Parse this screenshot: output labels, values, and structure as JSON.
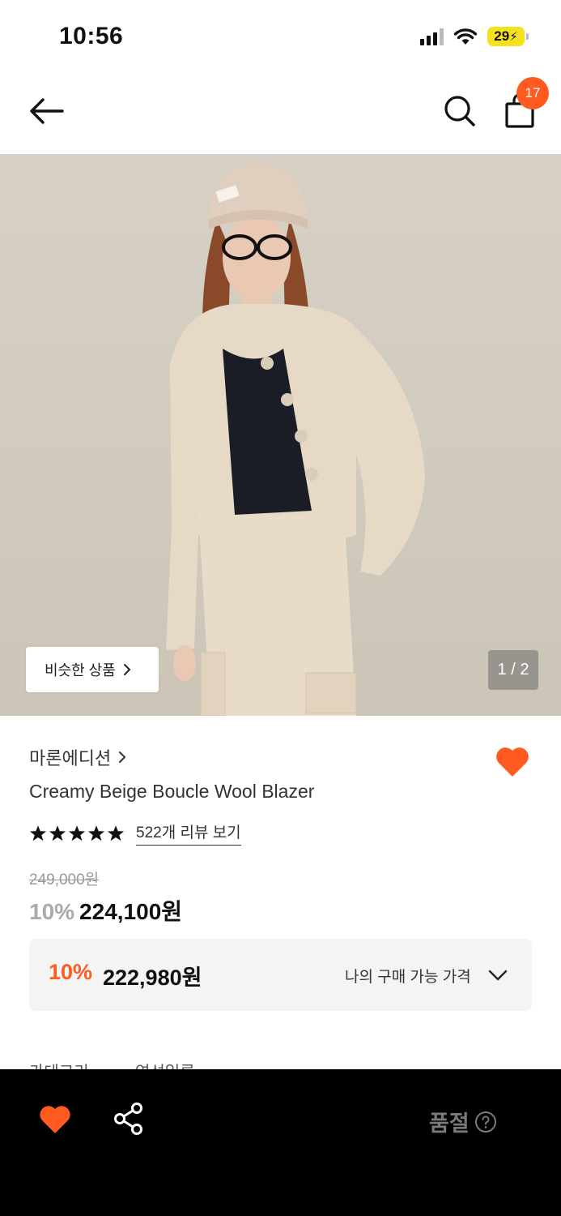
{
  "status_bar": {
    "time": "10:56",
    "battery": "29"
  },
  "nav": {
    "back_icon": "arrow-left-icon",
    "search_icon": "search-icon",
    "bag_icon": "shopping-bag-icon",
    "bag_count": "17"
  },
  "hero": {
    "similar_label": "비슷한 상품",
    "page_counter": "1 / 2"
  },
  "product": {
    "brand": "마론에디션",
    "title": "Creamy Beige Boucle Wool Blazer",
    "rating_stars": 5,
    "review_link": "522개 리뷰 보기",
    "original_price": "249,000원",
    "discount_pct": "10%",
    "sale_price": "224,100원"
  },
  "my_price": {
    "discount_pct": "10%",
    "price": "222,980원",
    "label": "나의 구매 가능 가격"
  },
  "cut_tabs": [
    "카테고리",
    "연선일류"
  ],
  "bottom_bar": {
    "soldout_label": "품절"
  },
  "colors": {
    "accent": "#ff5a1f",
    "bottom_bar": "#000000"
  }
}
